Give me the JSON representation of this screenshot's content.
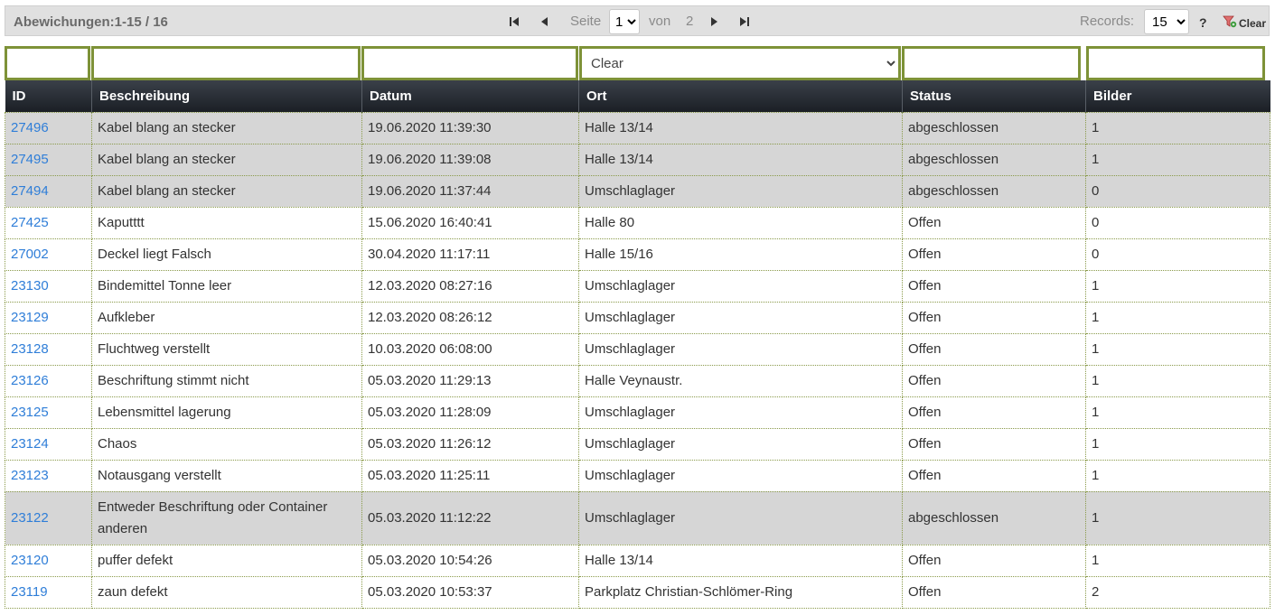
{
  "toolbar": {
    "title": "Abewichungen:1-15 / 16",
    "page_label": "Seite",
    "page_value": "1",
    "page_options": [
      "1",
      "2"
    ],
    "of_label": "von",
    "total_pages": "2",
    "records_label": "Records:",
    "records_value": "15",
    "records_options": [
      "15"
    ],
    "help_label": "?",
    "clear_label": "Clear"
  },
  "filters": {
    "ort_value": "Clear",
    "ort_options": [
      "Clear"
    ]
  },
  "table": {
    "columns": [
      "ID",
      "Beschreibung",
      "Datum",
      "Ort",
      "Status",
      "Bilder"
    ],
    "rows": [
      {
        "id": "27496",
        "beschreibung": "Kabel blang an stecker",
        "datum": "19.06.2020 11:39:30",
        "ort": "Halle 13/14",
        "status": "abgeschlossen",
        "bilder": "1"
      },
      {
        "id": "27495",
        "beschreibung": "Kabel blang an stecker",
        "datum": "19.06.2020 11:39:08",
        "ort": "Halle 13/14",
        "status": "abgeschlossen",
        "bilder": "1"
      },
      {
        "id": "27494",
        "beschreibung": "Kabel blang an stecker",
        "datum": "19.06.2020 11:37:44",
        "ort": "Umschlaglager",
        "status": "abgeschlossen",
        "bilder": "0"
      },
      {
        "id": "27425",
        "beschreibung": "Kaputttt",
        "datum": "15.06.2020 16:40:41",
        "ort": "Halle 80",
        "status": "Offen",
        "bilder": "0"
      },
      {
        "id": "27002",
        "beschreibung": "Deckel liegt Falsch",
        "datum": "30.04.2020 11:17:11",
        "ort": "Halle 15/16",
        "status": "Offen",
        "bilder": "0"
      },
      {
        "id": "23130",
        "beschreibung": "Bindemittel Tonne leer",
        "datum": "12.03.2020 08:27:16",
        "ort": "Umschlaglager",
        "status": "Offen",
        "bilder": "1"
      },
      {
        "id": "23129",
        "beschreibung": "Aufkleber",
        "datum": "12.03.2020 08:26:12",
        "ort": "Umschlaglager",
        "status": "Offen",
        "bilder": "1"
      },
      {
        "id": "23128",
        "beschreibung": "Fluchtweg verstellt",
        "datum": "10.03.2020 06:08:00",
        "ort": "Umschlaglager",
        "status": "Offen",
        "bilder": "1"
      },
      {
        "id": "23126",
        "beschreibung": "Beschriftung stimmt nicht",
        "datum": "05.03.2020 11:29:13",
        "ort": "Halle Veynaustr.",
        "status": "Offen",
        "bilder": "1"
      },
      {
        "id": "23125",
        "beschreibung": "Lebensmittel lagerung",
        "datum": "05.03.2020 11:28:09",
        "ort": "Umschlaglager",
        "status": "Offen",
        "bilder": "1"
      },
      {
        "id": "23124",
        "beschreibung": "Chaos",
        "datum": "05.03.2020 11:26:12",
        "ort": "Umschlaglager",
        "status": "Offen",
        "bilder": "1"
      },
      {
        "id": "23123",
        "beschreibung": "Notausgang verstellt",
        "datum": "05.03.2020 11:25:11",
        "ort": "Umschlaglager",
        "status": "Offen",
        "bilder": "1"
      },
      {
        "id": "23122",
        "beschreibung": "Entweder Beschriftung oder Container anderen",
        "datum": "05.03.2020 11:12:22",
        "ort": "Umschlaglager",
        "status": "abgeschlossen",
        "bilder": "1"
      },
      {
        "id": "23120",
        "beschreibung": "puffer defekt",
        "datum": "05.03.2020 10:54:26",
        "ort": "Halle 13/14",
        "status": "Offen",
        "bilder": "1"
      },
      {
        "id": "23119",
        "beschreibung": "zaun defekt",
        "datum": "05.03.2020 10:53:37",
        "ort": "Parkplatz Christian-Schlömer-Ring",
        "status": "Offen",
        "bilder": "2"
      }
    ]
  },
  "colors": {
    "closed_row": "#d6d6d6",
    "link": "#2f7ed8",
    "filter_border": "#7e9238",
    "header_bg": "#1b1f25"
  },
  "icons": [
    "first-page-icon",
    "prev-page-icon",
    "next-page-icon",
    "last-page-icon",
    "clear-filter-icon"
  ]
}
